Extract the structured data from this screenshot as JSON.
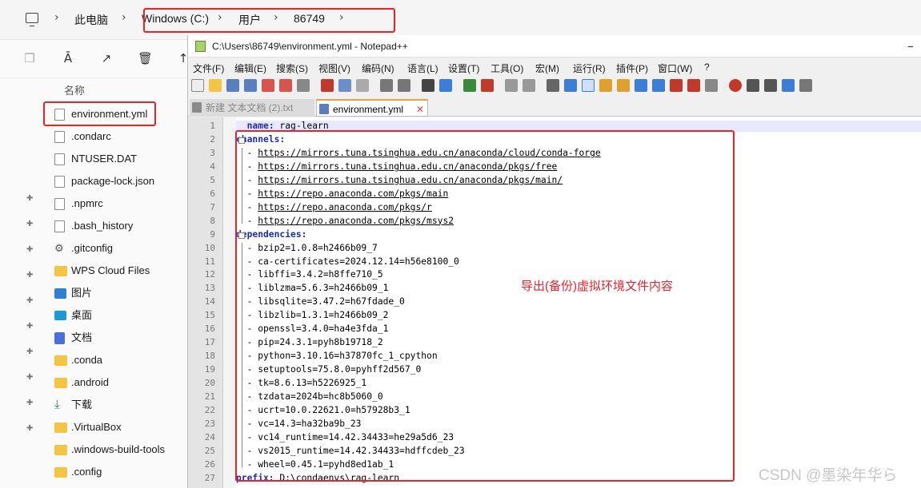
{
  "breadcrumb": {
    "items": [
      "此电脑",
      "Windows (C:)",
      "用户",
      "86749"
    ]
  },
  "explorer": {
    "column_header": "名称",
    "files": [
      {
        "name": "environment.yml",
        "icon": "file-icon"
      },
      {
        "name": ".condarc",
        "icon": "file-icon"
      },
      {
        "name": "NTUSER.DAT",
        "icon": "file-icon"
      },
      {
        "name": "package-lock.json",
        "icon": "file-icon"
      },
      {
        "name": ".npmrc",
        "icon": "file-icon"
      },
      {
        "name": ".bash_history",
        "icon": "file-icon"
      },
      {
        "name": ".gitconfig",
        "icon": "gear-icon"
      },
      {
        "name": "WPS Cloud Files",
        "icon": "folder-icon"
      },
      {
        "name": "图片",
        "icon": "pictures-icon"
      },
      {
        "name": "桌面",
        "icon": "desktop-icon"
      },
      {
        "name": "文档",
        "icon": "documents-icon"
      },
      {
        "name": ".conda",
        "icon": "folder-icon"
      },
      {
        "name": ".android",
        "icon": "folder-icon"
      },
      {
        "name": "下载",
        "icon": "download-icon"
      },
      {
        "name": ".VirtualBox",
        "icon": "folder-icon"
      },
      {
        "name": ".windows-build-tools",
        "icon": "folder-icon"
      },
      {
        "name": ".config",
        "icon": "folder-icon"
      }
    ]
  },
  "notepad": {
    "title": "C:\\Users\\86749\\environment.yml - Notepad++",
    "menu": [
      "文件(F)",
      "编辑(E)",
      "搜索(S)",
      "视图(V)",
      "编码(N)",
      "语言(L)",
      "设置(T)",
      "工具(O)",
      "宏(M)",
      "运行(R)",
      "插件(P)",
      "窗口(W)",
      "?"
    ],
    "tabs": [
      {
        "label": "新建 文本文档 (2).txt",
        "active": false
      },
      {
        "label": "environment.yml",
        "active": true
      }
    ],
    "lines": [
      "  name: rag-learn",
      "channels:",
      "  - https://mirrors.tuna.tsinghua.edu.cn/anaconda/cloud/conda-forge",
      "  - https://mirrors.tuna.tsinghua.edu.cn/anaconda/pkgs/free",
      "  - https://mirrors.tuna.tsinghua.edu.cn/anaconda/pkgs/main/",
      "  - https://repo.anaconda.com/pkgs/main",
      "  - https://repo.anaconda.com/pkgs/r",
      "  - https://repo.anaconda.com/pkgs/msys2",
      "dependencies:",
      "  - bzip2=1.0.8=h2466b09_7",
      "  - ca-certificates=2024.12.14=h56e8100_0",
      "  - libffi=3.4.2=h8ffe710_5",
      "  - liblzma=5.6.3=h2466b09_1",
      "  - libsqlite=3.47.2=h67fdade_0",
      "  - libzlib=1.3.1=h2466b09_2",
      "  - openssl=3.4.0=ha4e3fda_1",
      "  - pip=24.3.1=pyh8b19718_2",
      "  - python=3.10.16=h37870fc_1_cpython",
      "  - setuptools=75.8.0=pyhff2d567_0",
      "  - tk=8.6.13=h5226925_1",
      "  - tzdata=2024b=hc8b5060_0",
      "  - ucrt=10.0.22621.0=h57928b3_1",
      "  - vc=14.3=ha32ba9b_23",
      "  - vc14_runtime=14.42.34433=he29a5d6_23",
      "  - vs2015_runtime=14.42.34433=hdffcdeb_23",
      "  - wheel=0.45.1=pyhd8ed1ab_1",
      "prefix: D:\\condaenvs\\rag-learn"
    ]
  },
  "annotation": "导出(备份)虚拟环境文件内容",
  "watermark": "CSDN @墨染年华ら"
}
